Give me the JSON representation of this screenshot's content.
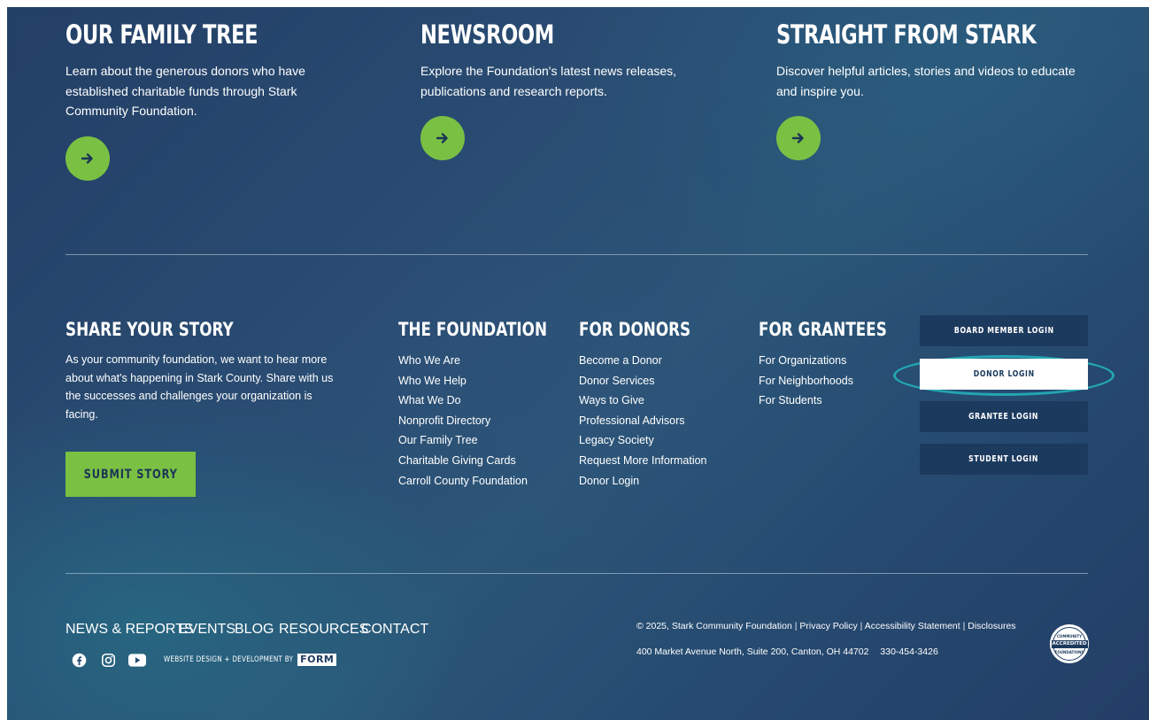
{
  "cards": [
    {
      "title": "OUR FAMILY TREE",
      "text": "Learn about the generous donors who have established charitable funds through Stark Community Foundation.",
      "button_icon": "arrow-right-icon"
    },
    {
      "title": "NEWSROOM",
      "text": "Explore the Foundation's latest news releases, publications and research reports.",
      "button_icon": "arrow-right-icon"
    },
    {
      "title": "STRAIGHT FROM STARK",
      "text": "Discover helpful articles, stories and videos to educate and inspire you.",
      "button_icon": "arrow-right-icon"
    }
  ],
  "share_story": {
    "title": "SHARE YOUR STORY",
    "text": "As your community foundation, we want to hear more about what's happening in Stark County. Share with us the successes and challenges your organization is facing.",
    "button_label": "SUBMIT STORY"
  },
  "columns": [
    {
      "title": "THE FOUNDATION",
      "links": [
        "Who We Are",
        "Who We Help",
        "What We Do",
        "Nonprofit Directory",
        "Our Family Tree",
        "Charitable Giving Cards",
        "Carroll County Foundation"
      ]
    },
    {
      "title": "FOR DONORS",
      "links": [
        "Become a Donor",
        "Donor Services",
        "Ways to Give",
        "Professional Advisors",
        "Legacy Society",
        "Request More Information",
        "Donor Login"
      ]
    },
    {
      "title": "FOR GRANTEES",
      "links": [
        "For Organizations",
        "For Neighborhoods",
        "For Students"
      ]
    }
  ],
  "logins": {
    "board": "BOARD MEMBER LOGIN",
    "donor": "DONOR LOGIN",
    "grantee": "GRANTEE LOGIN",
    "student": "STUDENT LOGIN"
  },
  "bottom_nav": [
    "NEWS & REPORTS",
    "EVENTS",
    "BLOG",
    "RESOURCES",
    "CONTACT"
  ],
  "social": [
    "facebook-icon",
    "instagram-icon",
    "youtube-icon"
  ],
  "credit": {
    "text": "WEBSITE DESIGN + DEVELOPMENT BY",
    "logo": "FORM"
  },
  "legal": {
    "copyright": "© 2025, Stark Community Foundation",
    "privacy": "Privacy Policy",
    "accessibility": "Accessibility Statement",
    "disclosures": "Disclosures",
    "address": "400 Market Avenue North, Suite 200, Canton, OH 44702",
    "phone": "330-454-3426"
  },
  "seal": {
    "top": "COMMUNITY",
    "main": "ACCREDITED",
    "bottom": "FOUNDATIONS"
  },
  "colors": {
    "background": "#264a70",
    "accent_green": "#7ac143",
    "button_dark": "#1c3a5e",
    "highlight": "#23a6b2"
  }
}
